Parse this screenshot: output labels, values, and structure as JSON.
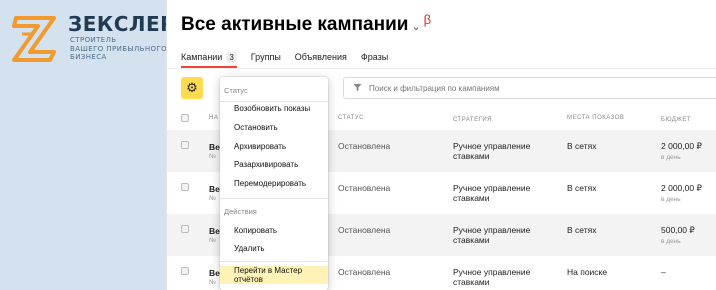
{
  "brand": {
    "name": "ЗЕКСЛЕР",
    "tagline_lines": [
      "СТРОИТЕЛЬ",
      "ВАШЕГО ПРИБЫЛЬНОГО",
      "БИЗНЕСА"
    ]
  },
  "header": {
    "title": "Все активные кампании",
    "beta": "β"
  },
  "tabs": [
    {
      "label": "Кампании",
      "count": "3",
      "active": true
    },
    {
      "label": "Группы"
    },
    {
      "label": "Объявления"
    },
    {
      "label": "Фразы"
    }
  ],
  "filter": {
    "placeholder": "Поиск и фильтрация по кампаниям"
  },
  "table": {
    "columns": {
      "name": "НА",
      "status": "СТАТУС",
      "strategy": "СТРАТЕГИЯ",
      "places": "МЕСТА ПОКАЗОВ",
      "budget": "БЮДЖЕТ"
    },
    "rows": [
      {
        "name": "Ве",
        "num": "№",
        "status": "Остановлена",
        "strategy": "Ручное управление ставками",
        "places": "В сетях",
        "budget": "2 000,00 ₽",
        "period": "в день"
      },
      {
        "name": "Ве",
        "num": "№",
        "status": "Остановлена",
        "strategy": "Ручное управление ставками",
        "places": "В сетях",
        "budget": "2 000,00 ₽",
        "period": "в день"
      },
      {
        "name": "Ве",
        "num": "№",
        "status": "Остановлена",
        "strategy": "Ручное управление ставками",
        "places": "В сетях",
        "budget": "500,00 ₽",
        "period": "в день"
      },
      {
        "name": "Ве",
        "num": "№",
        "status": "Остановлена",
        "strategy": "Ручное управление ставками",
        "places": "На поиске",
        "budget": "–",
        "period": ""
      }
    ]
  },
  "menu": {
    "status_label": "Статус",
    "status_items": [
      "Возобновить показы",
      "Остановить",
      "Архивировать",
      "Разархивировать",
      "Перемодерировать"
    ],
    "actions_label": "Действия",
    "action_items": [
      "Копировать",
      "Удалить"
    ],
    "footer_item": "Перейти в Мастер отчётов"
  },
  "colors": {
    "accent_tab": "#f44336",
    "gear_button": "#ffdb4d",
    "menu_highlight": "#fff3b8",
    "brand_orange": "#f29a2e"
  },
  "icons": {
    "gear": "gear-icon",
    "filter": "filter-icon",
    "dropdown": "chevron-down-icon"
  }
}
